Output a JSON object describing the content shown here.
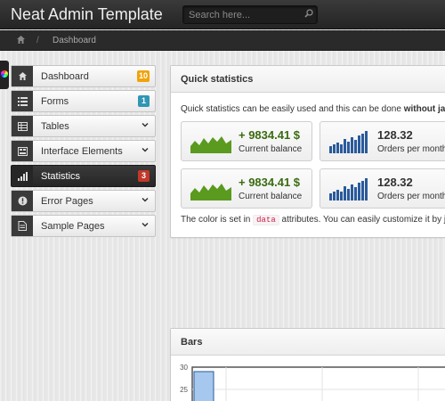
{
  "navbar": {
    "brand": "Neat Admin Template",
    "search_placeholder": "Search here..."
  },
  "breadcrumb": {
    "separator": "/",
    "current": "Dashboard"
  },
  "sidebar": {
    "items": [
      {
        "label": "Dashboard",
        "icon": "home-icon",
        "badge": "10",
        "badge_color": "#f0a30a"
      },
      {
        "label": "Forms",
        "icon": "list-icon",
        "badge": "1",
        "badge_color": "#2f96b4"
      },
      {
        "label": "Tables",
        "icon": "table-icon"
      },
      {
        "label": "Interface Elements",
        "icon": "interface-icon"
      },
      {
        "label": "Statistics",
        "icon": "statistics-icon",
        "badge": "3",
        "badge_color": "#c0392b",
        "active": true
      },
      {
        "label": "Error Pages",
        "icon": "error-icon"
      },
      {
        "label": "Sample Pages",
        "icon": "pages-icon"
      }
    ]
  },
  "quick_stats": {
    "title": "Quick statistics",
    "intro_prefix": "Quick statistics can be easily used and this can be done ",
    "intro_bold": "without ja",
    "stats": [
      {
        "value": "+ 9834.41 $",
        "label": "Current balance",
        "graph": "area",
        "color": "#5a9a1f"
      },
      {
        "value": "128.32",
        "label": "Orders per month",
        "graph": "bars",
        "color": "#2a5a9b"
      },
      {
        "value": "+ 9834.41 $",
        "label": "Current balance",
        "graph": "area",
        "color": "#5a9a1f"
      },
      {
        "value": "128.32",
        "label": "Orders per month",
        "graph": "bars",
        "color": "#2a5a9b"
      }
    ],
    "note_prefix": "The color is set in ",
    "note_code": "data",
    "note_suffix": " attributes. You can easily customize it by j"
  },
  "bars_panel": {
    "title": "Bars",
    "chart_data": {
      "type": "bar",
      "yticks": [
        "30",
        "25"
      ],
      "ylim": [
        20,
        30
      ],
      "values": [
        29
      ]
    }
  },
  "colors": {
    "accent_green": "#5a9a1f",
    "accent_blue": "#2a5a9b",
    "bar_fill": "#a7c8ee"
  }
}
